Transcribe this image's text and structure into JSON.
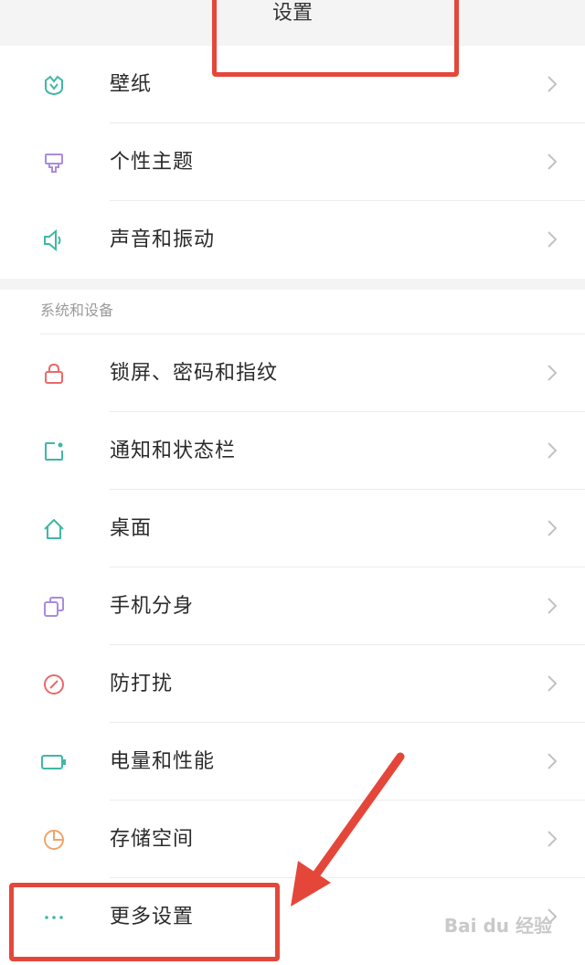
{
  "header": {
    "title": "设置"
  },
  "group1": {
    "items": [
      {
        "label": "壁纸",
        "icon": "wallpaper-icon"
      },
      {
        "label": "个性主题",
        "icon": "theme-brush-icon"
      },
      {
        "label": "声音和振动",
        "icon": "speaker-icon"
      }
    ]
  },
  "group2": {
    "title": "系统和设备",
    "items": [
      {
        "label": "锁屏、密码和指纹",
        "icon": "lock-icon"
      },
      {
        "label": "通知和状态栏",
        "icon": "notification-icon"
      },
      {
        "label": "桌面",
        "icon": "home-icon"
      },
      {
        "label": "手机分身",
        "icon": "second-space-icon"
      },
      {
        "label": "防打扰",
        "icon": "do-not-disturb-icon"
      },
      {
        "label": "电量和性能",
        "icon": "battery-icon"
      },
      {
        "label": "存储空间",
        "icon": "storage-pie-icon"
      },
      {
        "label": "更多设置",
        "icon": "more-dots-icon"
      }
    ]
  },
  "colors": {
    "annotation": "#e4473a",
    "icon_teal": "#3fb8a6",
    "icon_purple": "#a98be0",
    "icon_red": "#e86a6a",
    "icon_orange": "#f0a46a"
  },
  "watermark": "Bai du 经验"
}
